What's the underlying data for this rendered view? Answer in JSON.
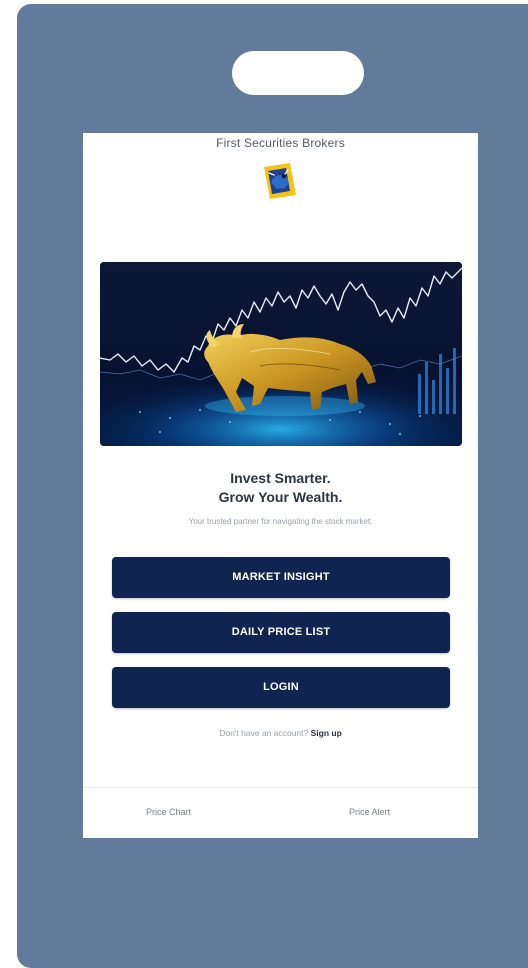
{
  "app": {
    "title": "First Securities Brokers"
  },
  "hero": {
    "headline_line1": "Invest Smarter.",
    "headline_line2": "Grow Your Wealth.",
    "tagline": "Your trusted partner for navigating the stock market."
  },
  "actions": {
    "market_insight": "MARKET INSIGHT",
    "daily_price_list": "DAILY PRICE LIST",
    "login": "LOGIN"
  },
  "signup": {
    "prompt": "Don't have an account?",
    "link": "Sign up"
  },
  "bottom_nav": {
    "items": [
      {
        "label": "Price Chart"
      },
      {
        "label": "Price Alert"
      }
    ]
  },
  "icons": {
    "logo": "bull-logo-icon",
    "hero_image": "golden-bull-chart-image"
  },
  "colors": {
    "device_frame": "#627b9b",
    "button_bg": "#0f2450",
    "button_text": "#ffffff",
    "hero_bg": "#06112a",
    "chart_line": "#e9eef7",
    "bull_gold": "#d1a22a"
  }
}
